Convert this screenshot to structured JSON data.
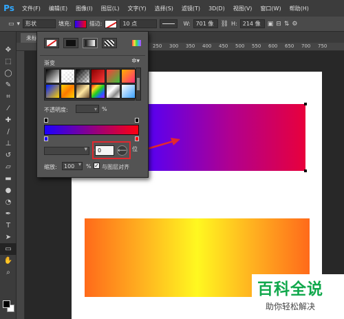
{
  "menubar": {
    "logo": "Ps",
    "items": [
      "文件(F)",
      "编辑(E)",
      "图像(I)",
      "图层(L)",
      "文字(Y)",
      "选择(S)",
      "滤镜(T)",
      "3D(D)",
      "视图(V)",
      "窗口(W)",
      "帮助(H)"
    ]
  },
  "options": {
    "mode": "形状",
    "fill_label": "填充:",
    "stroke_label": "描边:",
    "stroke_size": "10 点",
    "w_label": "W:",
    "w_value": "701 像",
    "h_label": "H:",
    "h_value": "214 像"
  },
  "tab": {
    "label": "未标"
  },
  "ruler": {
    "ticks": [
      "250",
      "300",
      "350",
      "400",
      "450",
      "500",
      "550",
      "600",
      "650",
      "700",
      "750"
    ]
  },
  "panel": {
    "gradient_label": "渐变",
    "opacity_label": "不透明度:",
    "opacity_unit": "%",
    "location_value": "0",
    "scale_label": "缩放:",
    "scale_value": "100",
    "scale_unit": "%",
    "align_label": "与图层对齐",
    "side_char": "位"
  },
  "colors": {
    "gradient_start": "#1c00ff",
    "gradient_end": "#ff0010",
    "highlight": "#e2282f",
    "arrow": "#e2282f",
    "watermark_green": "#11a84c"
  },
  "watermark": {
    "title": "百科全说",
    "subtitle": "助你轻松解决"
  }
}
